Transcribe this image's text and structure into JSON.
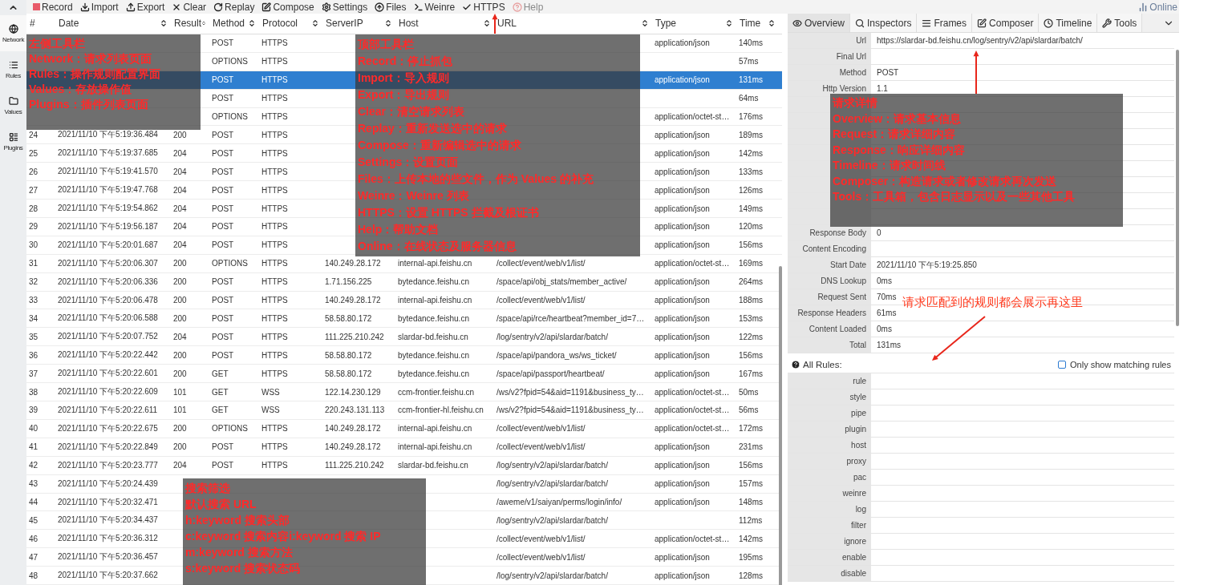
{
  "toolbar": {
    "buttons": [
      {
        "label": "Record",
        "disabled": false
      },
      {
        "label": "Import",
        "disabled": false
      },
      {
        "label": "Export",
        "disabled": false
      },
      {
        "label": "Clear",
        "disabled": false
      },
      {
        "label": "Replay",
        "disabled": false
      },
      {
        "label": "Compose",
        "disabled": false
      },
      {
        "label": "Settings",
        "disabled": false
      },
      {
        "label": "Files",
        "disabled": false
      },
      {
        "label": "Weinre",
        "disabled": false
      },
      {
        "label": "HTTPS",
        "disabled": false
      },
      {
        "label": "Help",
        "disabled": true
      }
    ],
    "status": "Online"
  },
  "sidebar": {
    "items": [
      {
        "label": "Network",
        "selected": true
      },
      {
        "label": "Rules",
        "selected": false
      },
      {
        "label": "Values",
        "selected": false
      },
      {
        "label": "Plugins",
        "selected": false
      }
    ]
  },
  "table": {
    "columns": [
      {
        "label": "#",
        "sortable": false
      },
      {
        "label": "Date",
        "sortable": true
      },
      {
        "label": "Result",
        "sortable": true
      },
      {
        "label": "Method",
        "sortable": true
      },
      {
        "label": "Protocol",
        "sortable": true
      },
      {
        "label": "ServerIP",
        "sortable": true
      },
      {
        "label": "Host",
        "sortable": true
      },
      {
        "label": "URL",
        "sortable": true
      },
      {
        "label": "Type",
        "sortable": true
      },
      {
        "label": "Time",
        "sortable": true
      }
    ],
    "rows": [
      {
        "selected": false,
        "cells": [
          null,
          null,
          null,
          "POST",
          "HTTPS",
          null,
          null,
          null,
          "application/json",
          "140ms"
        ]
      },
      {
        "selected": false,
        "cells": [
          null,
          null,
          null,
          "OPTIONS",
          "HTTPS",
          null,
          null,
          null,
          null,
          "57ms"
        ]
      },
      {
        "selected": true,
        "cells": [
          null,
          null,
          null,
          "POST",
          "HTTPS",
          null,
          null,
          null,
          "application/json",
          "131ms"
        ]
      },
      {
        "selected": false,
        "cells": [
          null,
          null,
          null,
          "POST",
          "HTTPS",
          null,
          null,
          null,
          null,
          "64ms"
        ]
      },
      {
        "selected": false,
        "cells": [
          null,
          null,
          null,
          "OPTIONS",
          "HTTPS",
          null,
          null,
          null,
          "application/octet-st…",
          "176ms"
        ]
      },
      {
        "selected": false,
        "cells": [
          "24",
          "2021/11/10 下午5:19:36.484",
          "200",
          "POST",
          "HTTPS",
          null,
          null,
          null,
          "application/json",
          "189ms"
        ]
      },
      {
        "selected": false,
        "cells": [
          "25",
          "2021/11/10 下午5:19:37.685",
          "204",
          "POST",
          "HTTPS",
          null,
          null,
          null,
          "application/json",
          "142ms"
        ]
      },
      {
        "selected": false,
        "cells": [
          "26",
          "2021/11/10 下午5:19:41.570",
          "204",
          "POST",
          "HTTPS",
          null,
          null,
          null,
          "application/json",
          "133ms"
        ]
      },
      {
        "selected": false,
        "cells": [
          "27",
          "2021/11/10 下午5:19:47.768",
          "204",
          "POST",
          "HTTPS",
          null,
          null,
          null,
          "application/json",
          "126ms"
        ]
      },
      {
        "selected": false,
        "cells": [
          "28",
          "2021/11/10 下午5:19:54.862",
          "204",
          "POST",
          "HTTPS",
          null,
          null,
          null,
          "application/json",
          "149ms"
        ]
      },
      {
        "selected": false,
        "cells": [
          "29",
          "2021/11/10 下午5:19:56.187",
          "204",
          "POST",
          "HTTPS",
          null,
          null,
          null,
          "application/json",
          "120ms"
        ]
      },
      {
        "selected": false,
        "cells": [
          "30",
          "2021/11/10 下午5:20:01.687",
          "204",
          "POST",
          "HTTPS",
          null,
          null,
          null,
          "application/json",
          "156ms"
        ]
      },
      {
        "selected": false,
        "cells": [
          "31",
          "2021/11/10 下午5:20:06.307",
          "200",
          "OPTIONS",
          "HTTPS",
          "140.249.28.172",
          "internal-api.feishu.cn",
          "/collect/event/web/v1/list/",
          "application/octet-st…",
          "169ms"
        ]
      },
      {
        "selected": false,
        "cells": [
          "32",
          "2021/11/10 下午5:20:06.336",
          "200",
          "POST",
          "HTTPS",
          "1.71.156.225",
          "bytedance.feishu.cn",
          "/space/api/obj_stats/member_active/",
          "application/json",
          "264ms"
        ]
      },
      {
        "selected": false,
        "cells": [
          "33",
          "2021/11/10 下午5:20:06.478",
          "200",
          "POST",
          "HTTPS",
          "140.249.28.172",
          "internal-api.feishu.cn",
          "/collect/event/web/v1/list/",
          "application/json",
          "188ms"
        ]
      },
      {
        "selected": false,
        "cells": [
          "34",
          "2021/11/10 下午5:20:06.588",
          "200",
          "POST",
          "HTTPS",
          "58.58.80.172",
          "bytedance.feishu.cn",
          "/space/api/rce/heartbeat?member_id=7…",
          "application/json",
          "153ms"
        ]
      },
      {
        "selected": false,
        "cells": [
          "35",
          "2021/11/10 下午5:20:07.752",
          "204",
          "POST",
          "HTTPS",
          "111.225.210.242",
          "slardar-bd.feishu.cn",
          "/log/sentry/v2/api/slardar/batch/",
          "application/json",
          "122ms"
        ]
      },
      {
        "selected": false,
        "cells": [
          "36",
          "2021/11/10 下午5:20:22.442",
          "200",
          "POST",
          "HTTPS",
          "58.58.80.172",
          "bytedance.feishu.cn",
          "/space/api/pandora_ws/ws_ticket/",
          "application/json",
          "156ms"
        ]
      },
      {
        "selected": false,
        "cells": [
          "37",
          "2021/11/10 下午5:20:22.601",
          "200",
          "GET",
          "HTTPS",
          "58.58.80.172",
          "bytedance.feishu.cn",
          "/space/api/passport/heartbeat/",
          "application/json",
          "167ms"
        ]
      },
      {
        "selected": false,
        "cells": [
          "38",
          "2021/11/10 下午5:20:22.609",
          "101",
          "GET",
          "WSS",
          "122.14.230.129",
          "ccm-frontier.feishu.cn",
          "/ws/v2?fpid=54&aid=1191&business_ty…",
          "application/octet-st…",
          "50ms"
        ]
      },
      {
        "selected": false,
        "cells": [
          "39",
          "2021/11/10 下午5:20:22.611",
          "101",
          "GET",
          "WSS",
          "220.243.131.113",
          "ccm-frontier-hl.feishu.cn",
          "/ws/v2?fpid=54&aid=1191&business_ty…",
          "application/octet-st…",
          "56ms"
        ]
      },
      {
        "selected": false,
        "cells": [
          "40",
          "2021/11/10 下午5:20:22.675",
          "200",
          "OPTIONS",
          "HTTPS",
          "140.249.28.172",
          "internal-api.feishu.cn",
          "/collect/event/web/v1/list/",
          "application/octet-st…",
          "172ms"
        ]
      },
      {
        "selected": false,
        "cells": [
          "41",
          "2021/11/10 下午5:20:22.849",
          "200",
          "POST",
          "HTTPS",
          "140.249.28.172",
          "internal-api.feishu.cn",
          "/collect/event/web/v1/list/",
          "application/json",
          "231ms"
        ]
      },
      {
        "selected": false,
        "cells": [
          "42",
          "2021/11/10 下午5:20:23.777",
          "204",
          "POST",
          "HTTPS",
          "111.225.210.242",
          "slardar-bd.feishu.cn",
          "/log/sentry/v2/api/slardar/batch/",
          "application/json",
          "156ms"
        ]
      },
      {
        "selected": false,
        "cells": [
          "43",
          "2021/11/10 下午5:20:24.439",
          null,
          null,
          null,
          null,
          null,
          "/log/sentry/v2/api/slardar/batch/",
          "application/json",
          "157ms"
        ]
      },
      {
        "selected": false,
        "cells": [
          "44",
          "2021/11/10 下午5:20:32.471",
          null,
          null,
          null,
          null,
          null,
          "/aweme/v1/saiyan/perms/login/info/",
          "application/json",
          "148ms"
        ]
      },
      {
        "selected": false,
        "cells": [
          "45",
          "2021/11/10 下午5:20:34.437",
          null,
          null,
          null,
          null,
          null,
          "/log/sentry/v2/api/slardar/batch/",
          null,
          "112ms"
        ]
      },
      {
        "selected": false,
        "cells": [
          "46",
          "2021/11/10 下午5:20:36.312",
          null,
          null,
          null,
          null,
          null,
          "/collect/event/web/v1/list/",
          "application/octet-st…",
          "142ms"
        ]
      },
      {
        "selected": false,
        "cells": [
          "47",
          "2021/11/10 下午5:20:36.457",
          null,
          null,
          null,
          null,
          null,
          "/collect/event/web/v1/list/",
          "application/json",
          "195ms"
        ]
      },
      {
        "selected": false,
        "cells": [
          "48",
          "2021/11/10 下午5:20:37.662",
          null,
          null,
          null,
          null,
          null,
          "/log/sentry/v2/api/slardar/batch/",
          "application/json",
          "128ms"
        ]
      }
    ]
  },
  "detail": {
    "tabs": [
      {
        "label": "Overview",
        "selected": true
      },
      {
        "label": "Inspectors",
        "selected": false
      },
      {
        "label": "Frames",
        "selected": false
      },
      {
        "label": "Composer",
        "selected": false
      },
      {
        "label": "Timeline",
        "selected": false
      },
      {
        "label": "Tools",
        "selected": false
      }
    ],
    "fields": [
      {
        "label": "Url",
        "value": "https://slardar-bd.feishu.cn/log/sentry/v2/api/slardar/batch/"
      },
      {
        "label": "Final Url"
      },
      {
        "label": "Method",
        "value": "POST"
      },
      {
        "label": "Http Version",
        "value": "1.1"
      }
    ],
    "fields_below": [
      {
        "label": "Response Body",
        "value": "0"
      },
      {
        "label": "Content Encoding"
      },
      {
        "label": "Start Date",
        "value": "2021/11/10 下午5:19:25.850"
      },
      {
        "label": "DNS Lookup",
        "value": "0ms"
      },
      {
        "label": "Request Sent",
        "value": "70ms"
      },
      {
        "label": "Response Headers",
        "value": "61ms"
      },
      {
        "label": "Content Loaded",
        "value": "0ms"
      },
      {
        "label": "Total",
        "value": "131ms"
      }
    ],
    "rules": {
      "title": "All Rules:",
      "filter": {
        "label": "Only show matching rules",
        "checked": false
      },
      "items": [
        "rule",
        "style",
        "pipe",
        "plugin",
        "host",
        "proxy",
        "pac",
        "weinre",
        "log",
        "filter",
        "ignore",
        "enable",
        "disable"
      ]
    }
  },
  "annotations": [
    {
      "lines": [
        "左侧工具栏",
        "Network：请求列表页面",
        "Rules：操作规则配置界面",
        "Values：存放操作值",
        "Plugins：插件列表页面"
      ]
    },
    {
      "lines": [
        "顶部工具栏",
        "Record：停止抓包",
        "Import：导入规则",
        "Export：导出规则",
        "Clear：清空请求列表",
        "Replay：重新发送选中的请求",
        "Compose：重新编辑选中的请求",
        "Settings：设置页面",
        "Files：上传本地的些文件，作为 Values 的补充",
        "Weinre：Weinre 列表",
        "HTTPS：设置 HTTPS 拦截及根证书",
        "Help：帮助文档",
        "Online：在线状态及服务器信息"
      ]
    },
    {
      "lines": [
        "请求详情",
        "Overview：请求基本信息",
        "Request：请求详细内容",
        "Response：响应详细内容",
        "Timeline：请求时间线",
        "Composer：构造请求或者修改请求再次发送",
        "Tools：工具箱，包含日志显示以及一些其他工具"
      ]
    },
    {
      "lines": [
        "搜索筛选",
        "默认搜索 URL",
        "h:keyword 搜索头部",
        "c:keyword 搜索内容i:keyword 搜索 IP",
        "m:keyword 搜索方法",
        "s:keyword 搜索状态码"
      ]
    }
  ],
  "callout": "请求匹配到的规则都会展示再这里"
}
